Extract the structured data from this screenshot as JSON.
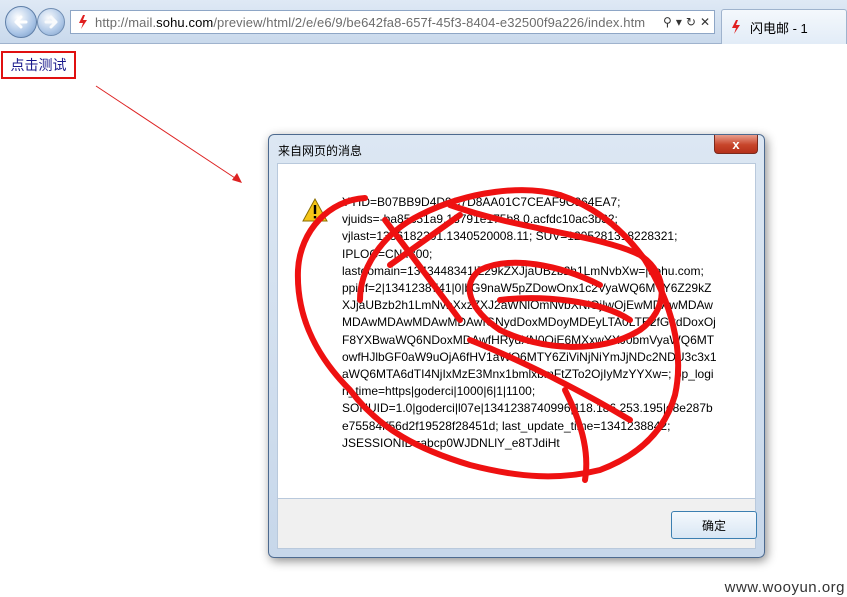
{
  "browser": {
    "url_prefix": "http://mail.",
    "url_domain": "sohu.com",
    "url_suffix": "/preview/html/2/e/e6/9/be642fa8-657f-45f3-8404-e32500f9a226/index.htm",
    "tab_title": "闪电邮 - 1"
  },
  "page": {
    "test_link": "点击测试"
  },
  "dialog": {
    "title": "来自网页的消息",
    "close": "x",
    "ok_label": "确定",
    "message_lines": [
      "YYID=B07BB9D4D9C7D8AA01C7CEAF9C964EA7;",
      "vjuids=-ba85c51a9.13791e175b8.0.acfdc10ac3b32;",
      "vjlast=1336182301.1340520008.11; SUV=1205281318228321;",
      "IPLOC=CN4300;",
      "lastdomain=1343448341|Z29kZXJjaUBzb2h1LmNvbXw=|sohu.com;",
      "ppinf=2|1341238741|0|bG9naW5pZDowOnx1c2VyaWQ6MTY6Z29kZXJjaUBzb2h1LmNvbXxzZXJ2aWNlOmNvbXNlOjIwOjEwMDAwMDAwMDAwMDAwMDAwMDAwfGNydDoxMDoyMDEyLTA0LTE2fGttdDoxOjF8YXBwaWQ6NDoxMDAwfHRydXN0OjE6MXxwYXJ0bmVyaWQ6MTowfHJlbGF0aW9uOjA6fHV1aWQ6MTY6ZiViNjNiYmJjNDc2NDU3c3x1aWQ6MTA6dTI4NjIxMzE3Mnx1bmlxbmFtZTo2OjIyMzYYXw=; pp_login_time=https|goderci|1000|6|1|1100;",
      "SOHUID=1.0|goderci|l07e|1341238740996|118.186.253.195|d8e287be75584ff56d2f19528f28451d; last_update_time=1341238842;",
      "JSESSIONID=abcp0WJDNLlY_e8TJdiHt"
    ]
  },
  "watermark": "www.wooyun.org",
  "colors": {
    "annotation_red": "#ee1111",
    "link_blue": "#1a1a8c"
  }
}
